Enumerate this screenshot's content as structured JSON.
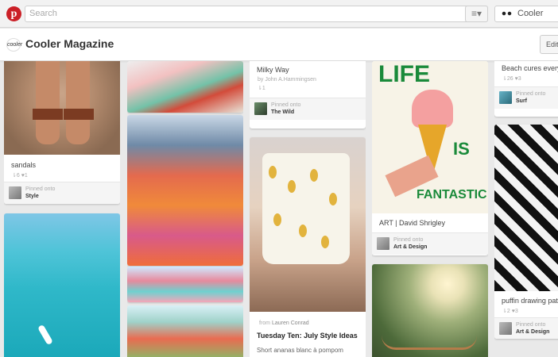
{
  "topbar": {
    "search_placeholder": "Search",
    "menu_icon": "hamburger-menu-icon",
    "user_name": "Cooler"
  },
  "board": {
    "title": "Cooler Magazine",
    "avatar_text": "cooler",
    "edit_label": "Edit"
  },
  "pins": [
    {
      "desc": "sandals",
      "stats": "⇂6 ♥1",
      "pinned_label": "Pinned onto",
      "board": "Style"
    },
    {
      "desc": "Milky Way",
      "via": "by John A.Hammingsen",
      "stats": "⇂1",
      "pinned_label": "Pinned onto",
      "board": "The Wild"
    },
    {
      "desc": "ART | David Shrigley",
      "pinned_label": "Pinned onto",
      "board": "Art & Design",
      "art_text_1": "LIFE",
      "art_text_2": "IS",
      "art_text_3": "FANTASTIC"
    },
    {
      "desc": "Beach cures everyth",
      "stats": "⇂26 ♥3",
      "pinned_label": "Pinned onto",
      "board": "Surf"
    },
    {
      "via_prefix": "from",
      "via_name": "Lauren Conrad",
      "desc": "Tuesday Ten: July Style Ideas",
      "sub": "Short ananas blanc à pompom"
    },
    {
      "desc": "puffin drawing patte",
      "stats": "⇂2 ♥3",
      "pinned_label": "Pinned onto",
      "board": "Art & Design"
    }
  ],
  "colors": {
    "pinterest_red": "#cb2027",
    "art_green": "#1a8a3a",
    "cone_pink": "#f4a0a0"
  }
}
